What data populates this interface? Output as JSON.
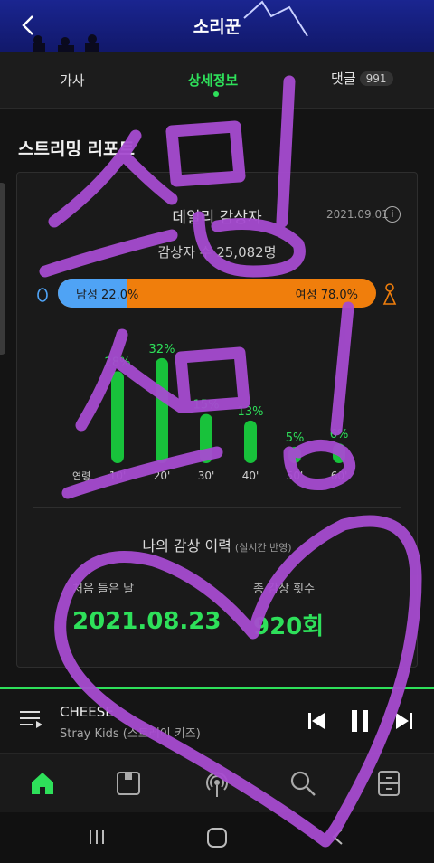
{
  "header": {
    "title": "소리꾼"
  },
  "tabs": [
    {
      "label": "가사"
    },
    {
      "label": "상세정보"
    },
    {
      "label": "댓글",
      "badge": "991"
    }
  ],
  "report": {
    "section_title": "스트리밍 리포트",
    "daily_title": "데일리 감상자",
    "date": "2021.09.01",
    "listeners": "감상자 수 25,082명",
    "gender": {
      "male_label": "남성 22.0%",
      "female_label": "여성 78.0%",
      "male_fraction": 0.22
    }
  },
  "chart_data": {
    "type": "bar",
    "categories": [
      "10'",
      "20'",
      "30'",
      "40'",
      "50'",
      "60'"
    ],
    "values": [
      28,
      32,
      15,
      13,
      5,
      6
    ],
    "value_labels": [
      "28%",
      "32%",
      "15%",
      "13%",
      "5%",
      "6%"
    ],
    "xlabel": "연령",
    "ylim": [
      0,
      35
    ],
    "color": "#18c23b"
  },
  "history": {
    "title": "나의 감상 이력",
    "subtitle": "(실시간 반영)",
    "first_label": "처음 들은 날",
    "first_value": "2021.08.23",
    "total_label": "총 감상 횟수",
    "total_value": "920회"
  },
  "player": {
    "title": "CHEESE",
    "artist": "Stray Kids (스트레이 키즈)",
    "progress_fraction": 1.0
  },
  "colors": {
    "accent": "#2ee05a",
    "male": "#4fa3f5",
    "female": "#f07e0c",
    "scribble": "#a64bd0"
  }
}
